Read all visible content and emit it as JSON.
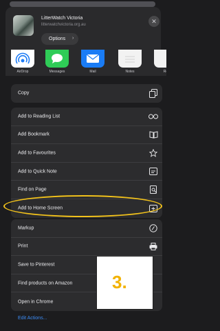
{
  "header": {
    "site_title": "LitterWatch Victoria",
    "site_url": "litterwatchvictoria.org.au",
    "options_label": "Options",
    "close_icon": "close-icon"
  },
  "apps": [
    {
      "label": "AirDrop",
      "icon": "airdrop-icon",
      "color": "#1e7cf5"
    },
    {
      "label": "Messages",
      "icon": "messages-icon",
      "color": "#2fcc57"
    },
    {
      "label": "Mail",
      "icon": "mail-icon",
      "color": "#1a7cf5"
    },
    {
      "label": "Notes",
      "icon": "notes-icon",
      "color": "#f2f2f2"
    },
    {
      "label": "Re",
      "icon": "reminders-icon",
      "color": "#f2f2f2"
    }
  ],
  "group1": [
    {
      "label": "Copy",
      "icon": "copy-icon"
    }
  ],
  "group2": [
    {
      "label": "Add to Reading List",
      "icon": "glasses-icon"
    },
    {
      "label": "Add Bookmark",
      "icon": "book-icon"
    },
    {
      "label": "Add to Favourites",
      "icon": "star-icon"
    },
    {
      "label": "Add to Quick Note",
      "icon": "quick-note-icon"
    },
    {
      "label": "Find on Page",
      "icon": "find-on-page-icon"
    },
    {
      "label": "Add to Home Screen",
      "icon": "add-square-icon"
    }
  ],
  "group3": [
    {
      "label": "Markup",
      "icon": "markup-icon"
    },
    {
      "label": "Print",
      "icon": "printer-icon"
    },
    {
      "label": "Save to Pinterest",
      "icon": "pinterest-icon"
    },
    {
      "label": "Find products on Amazon",
      "icon": "amazon-icon"
    },
    {
      "label": "Open in Chrome",
      "icon": "chrome-icon"
    }
  ],
  "edit_actions_label": "Edit Actions...",
  "callout_label": "3.",
  "colors": {
    "highlight": "#f2c21b",
    "callout_text": "#f2b200",
    "link": "#3d8cf5"
  }
}
